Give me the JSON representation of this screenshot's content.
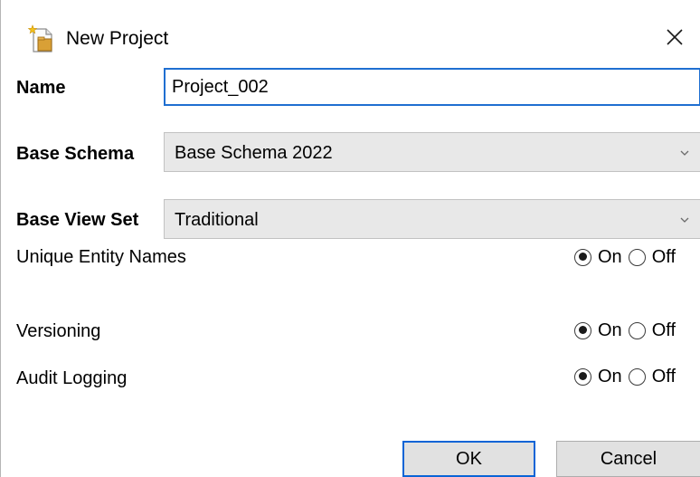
{
  "dialog": {
    "title": "New Project",
    "close_glyph": "×"
  },
  "fields": {
    "name": {
      "label": "Name",
      "value": "Project_002"
    },
    "base_schema": {
      "label": "Base Schema",
      "value": "Base Schema 2022"
    },
    "base_view_set": {
      "label": "Base View Set",
      "value": "Traditional"
    }
  },
  "options": [
    {
      "label": "Unique Entity Names",
      "on_label": "On",
      "off_label": "Off",
      "selected": "On"
    },
    {
      "label": "Versioning",
      "on_label": "On",
      "off_label": "Off",
      "selected": "On"
    },
    {
      "label": "Audit Logging",
      "on_label": "On",
      "off_label": "Off",
      "selected": "On"
    }
  ],
  "buttons": {
    "ok_label": "OK",
    "cancel_label": "Cancel"
  },
  "icons": {
    "title": "new-project-icon",
    "close": "close-icon",
    "dropdown": "chevron-down-icon"
  }
}
